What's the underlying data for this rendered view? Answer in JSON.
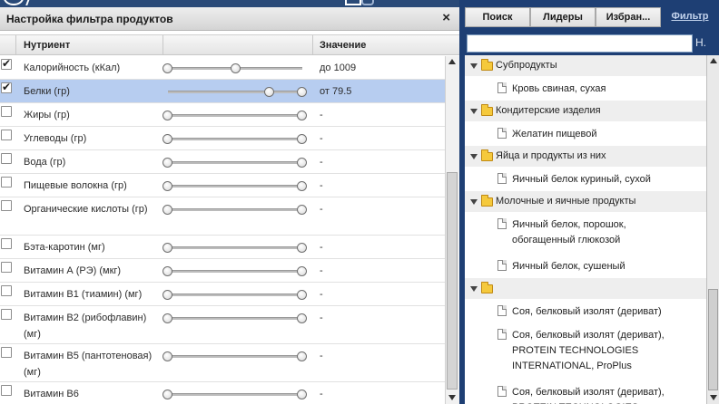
{
  "dialog": {
    "title": "Настройка фильтра продуктов",
    "close_icon": "×",
    "columns": {
      "nutrient": "Нутриент",
      "value": "Значение"
    },
    "rows": [
      {
        "checked": true,
        "selected": false,
        "name": "Калорийность (кКал)",
        "value": "до 1009",
        "slider": [
          0.0,
          0.51
        ]
      },
      {
        "checked": true,
        "selected": true,
        "name": "Белки (гр)",
        "value": "от 79.5",
        "slider": [
          0.76,
          1.0
        ]
      },
      {
        "checked": false,
        "selected": false,
        "name": "Жиры (гр)",
        "value": "-",
        "slider": [
          0.0,
          1.0
        ]
      },
      {
        "checked": false,
        "selected": false,
        "name": "Углеводы (гр)",
        "value": "-",
        "slider": [
          0.0,
          1.0
        ]
      },
      {
        "checked": false,
        "selected": false,
        "name": "Вода (гр)",
        "value": "-",
        "slider": [
          0.0,
          1.0
        ]
      },
      {
        "checked": false,
        "selected": false,
        "name": "Пищевые волокна (гр)",
        "value": "-",
        "slider": [
          0.0,
          1.0
        ]
      },
      {
        "checked": false,
        "selected": false,
        "name": "Органические кислоты (гр)",
        "value": "-",
        "slider": [
          0.0,
          1.0
        ]
      },
      {
        "checked": false,
        "selected": false,
        "name": "Бэта-каротин (мг)",
        "value": "-",
        "slider": [
          0.0,
          1.0
        ]
      },
      {
        "checked": false,
        "selected": false,
        "name": "Витамин А (РЭ) (мкг)",
        "value": "-",
        "slider": [
          0.0,
          1.0
        ]
      },
      {
        "checked": false,
        "selected": false,
        "name": "Витамин В1 (тиамин) (мг)",
        "value": "-",
        "slider": [
          0.0,
          1.0
        ]
      },
      {
        "checked": false,
        "selected": false,
        "name": "Витамин В2 (рибофлавин) (мг)",
        "value": "-",
        "slider": [
          0.0,
          1.0
        ]
      },
      {
        "checked": false,
        "selected": false,
        "name": "Витамин В5 (пантотеновая) (мг)",
        "value": "-",
        "slider": [
          0.0,
          1.0
        ]
      },
      {
        "checked": false,
        "selected": false,
        "name": "Витамин В6",
        "value": "-",
        "slider": [
          0.0,
          1.0
        ]
      }
    ]
  },
  "right": {
    "tabs": [
      {
        "label": "Поиск",
        "active": false
      },
      {
        "label": "Лидеры",
        "active": false
      },
      {
        "label": "Избран...",
        "active": false
      },
      {
        "label": "Фильтр",
        "active": true
      }
    ],
    "search_value": "",
    "search_button": "Н.",
    "tree": [
      {
        "type": "folder",
        "label": "Субпродукты"
      },
      {
        "type": "leaf",
        "label": "Кровь свиная, сухая"
      },
      {
        "type": "folder",
        "label": "Кондитерские изделия"
      },
      {
        "type": "leaf",
        "label": "Желатин пищевой"
      },
      {
        "type": "folder",
        "label": "Яйца и продукты из них"
      },
      {
        "type": "leaf",
        "label": "Яичный белок куриный, сухой"
      },
      {
        "type": "folder",
        "label": "Молочные и яичные продукты"
      },
      {
        "type": "leaf",
        "label": "Яичный белок, порошок,\nобогащенный глюкозой"
      },
      {
        "type": "leaf",
        "label": "Яичный белок, сушеный"
      },
      {
        "type": "folder",
        "label": ""
      },
      {
        "type": "leaf",
        "label": "Соя, белковый изолят (дериват)"
      },
      {
        "type": "leaf",
        "label": "Соя, белковый изолят (дериват),\nPROTEIN TECHNOLOGIES\nINTERNATIONAL, ProPlus"
      },
      {
        "type": "leaf",
        "label": "Соя, белковый изолят (дериват),\nPROTEIN TECHNOLOGIES"
      }
    ]
  }
}
